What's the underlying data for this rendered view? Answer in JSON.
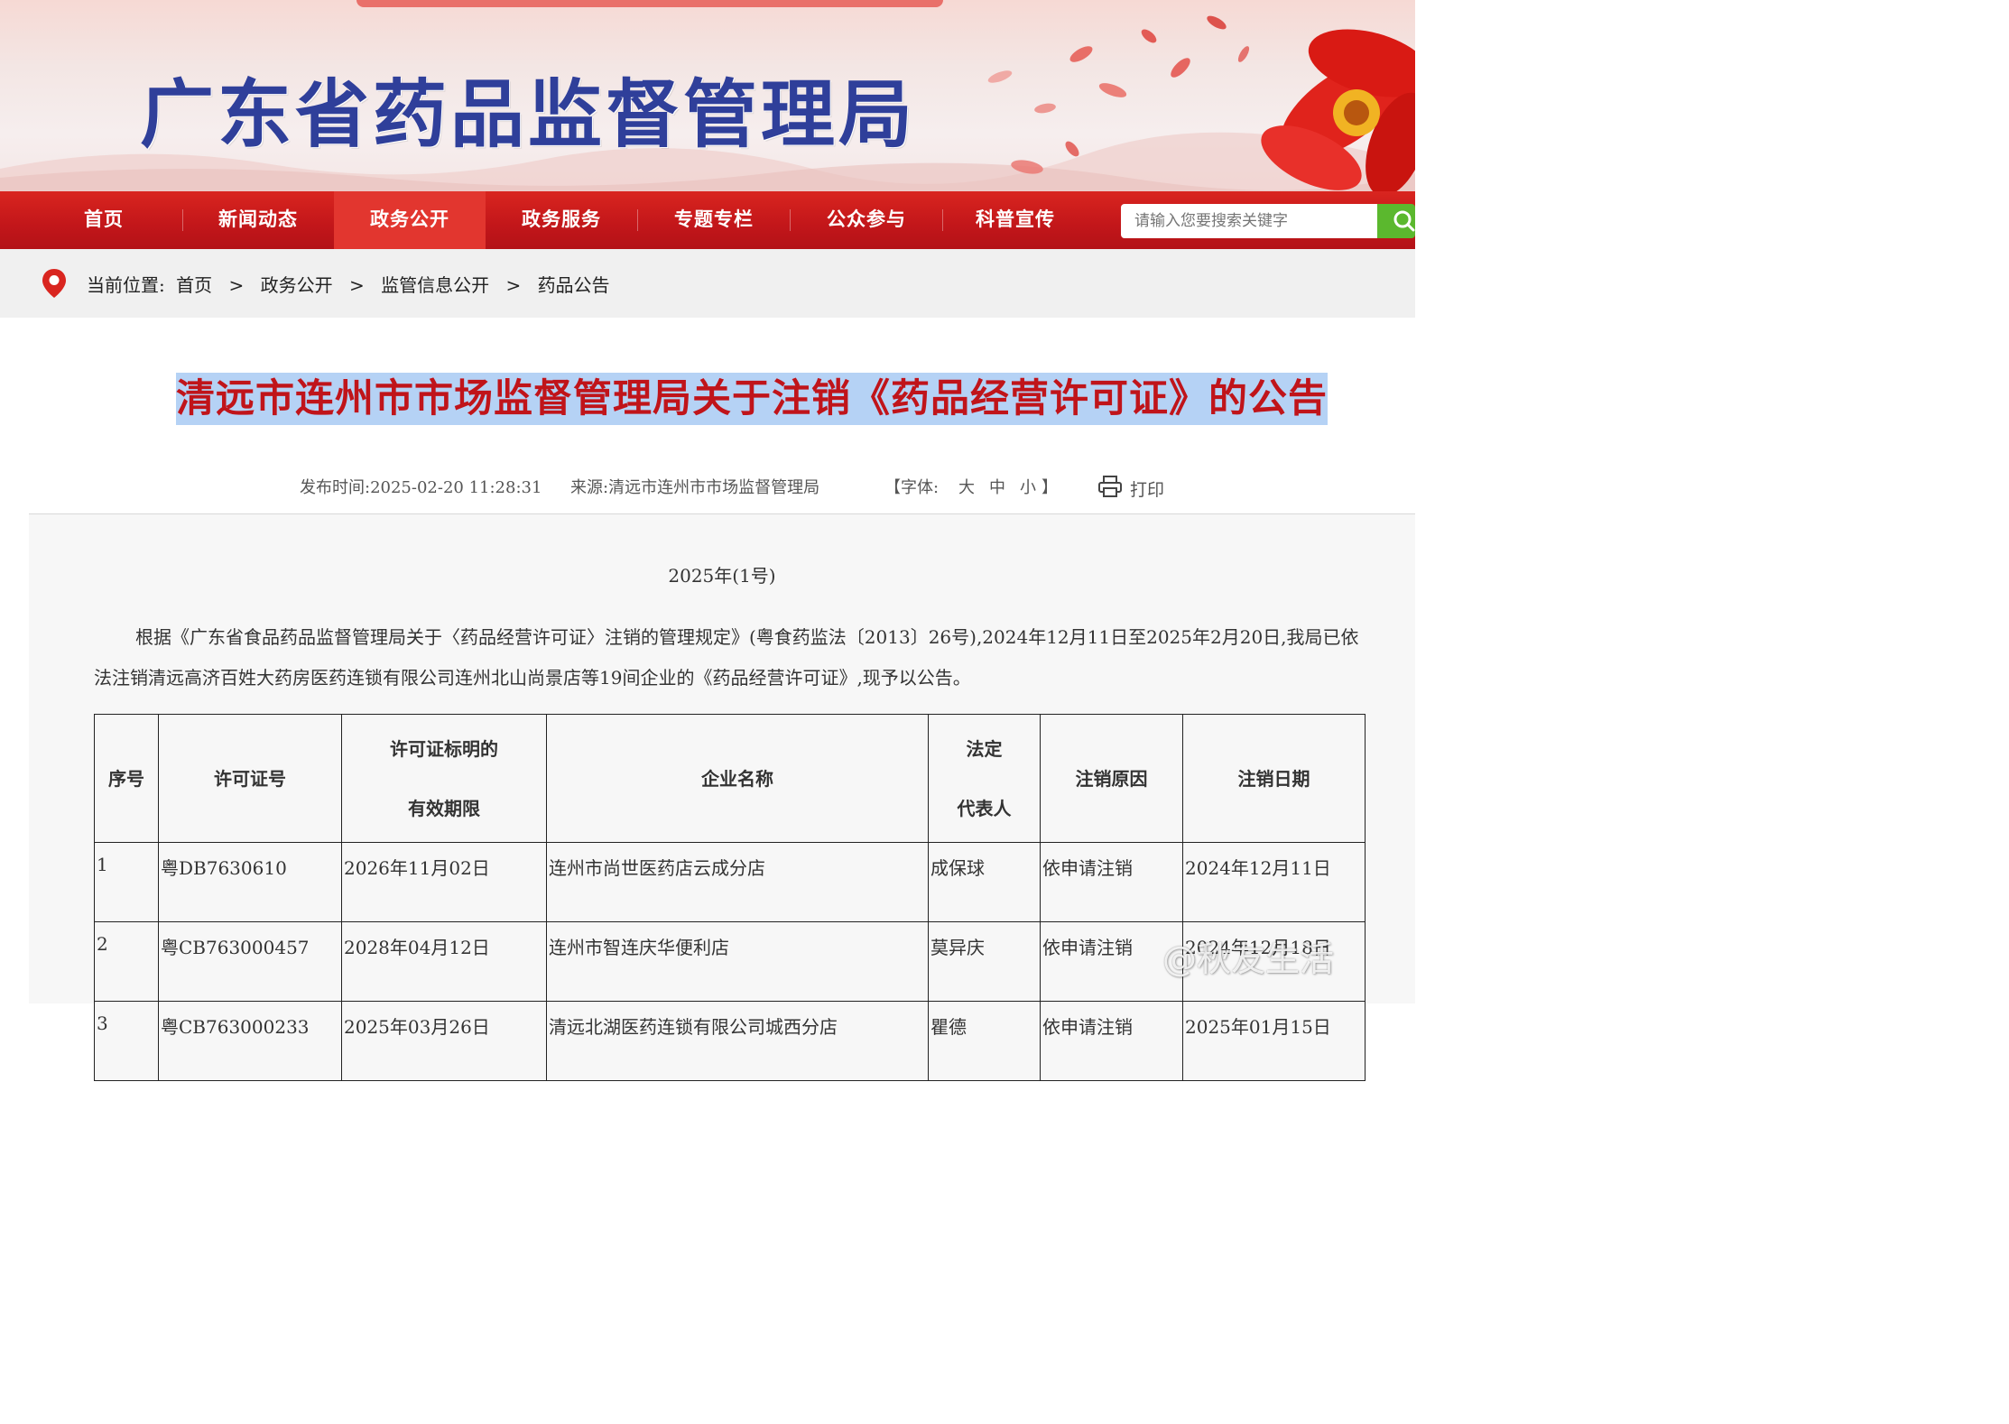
{
  "header": {
    "site_title": "广东省药品监督管理局"
  },
  "nav": {
    "items": [
      "首页",
      "新闻动态",
      "政务公开",
      "政务服务",
      "专题专栏",
      "公众参与",
      "科普宣传"
    ],
    "active_index": 2,
    "search_placeholder": "请输入您要搜索关键字",
    "search_icon": "search-icon"
  },
  "breadcrumb": {
    "label": "当前位置:",
    "items": [
      "首页",
      "政务公开",
      "监管信息公开",
      "药品公告"
    ],
    "separator": ">"
  },
  "article": {
    "title": "清远市连州市市场监督管理局关于注销《药品经营许可证》的公告",
    "publish_time": "发布时间:2025-02-20 11:28:31",
    "source": "来源:清远市连州市市场监督管理局",
    "font_size_label": "【字体:",
    "font_large": "大",
    "font_medium": "中",
    "font_small": "小",
    "font_close": "】",
    "print_label": "打印",
    "issue_number": "2025年(1号)",
    "paragraph": "根据《广东省食品药品监督管理局关于〈药品经营许可证〉注销的管理规定》(粤食药监法〔2013〕26号),2024年12月11日至2025年2月20日,我局已依法注销清远高济百姓大药房医药连锁有限公司连州北山尚景店等19间企业的《药品经营许可证》,现予以公告。"
  },
  "table": {
    "headers": {
      "seq": "序号",
      "license": "许可证号",
      "validity_1": "许可证标明的",
      "validity_2": "有效期限",
      "company": "企业名称",
      "rep_1": "法定",
      "rep_2": "代表人",
      "reason": "注销原因",
      "date": "注销日期"
    },
    "rows": [
      [
        "1",
        "粤DB7630610",
        "2026年11月02日",
        "连州市尚世医药店云成分店",
        "成保球",
        "依申请注销",
        "2024年12月11日"
      ],
      [
        "2",
        "粤CB763000457",
        "2028年04月12日",
        "连州市智连庆华便利店",
        "莫异庆",
        "依申请注销",
        "2024年12月18日"
      ],
      [
        "3",
        "粤CB763000233",
        "2025年03月26日",
        "清远北湖医药连锁有限公司城西分店",
        "瞿德",
        "依申请注销",
        "2025年01月15日"
      ]
    ]
  },
  "watermark": "@秋友生活",
  "colors": {
    "nav_red": "#c2161a",
    "title_red": "#c0141a",
    "title_highlight": "#b5d2f5",
    "banner_title_blue": "#2f3f9a",
    "search_green": "#5bb82e"
  }
}
